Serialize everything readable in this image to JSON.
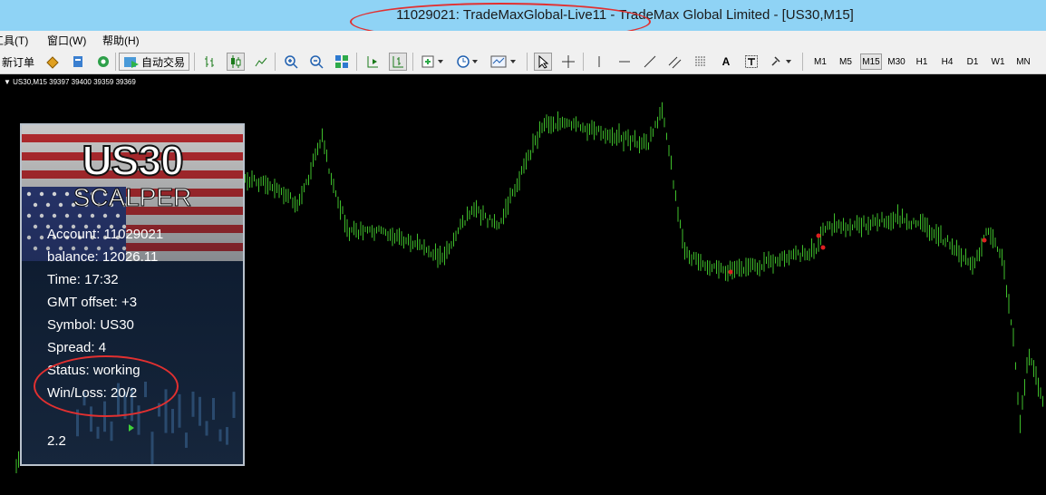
{
  "window": {
    "title": "11029021: TradeMaxGlobal-Live11 - TradeMax Global Limited - [US30,M15]"
  },
  "menu": {
    "items": [
      "工具(T)",
      "窗口(W)",
      "帮助(H)"
    ]
  },
  "toolbar": {
    "new_order_label": "新订单",
    "auto_trading_label": "自动交易",
    "text_tool_label": "A",
    "timeframes": [
      "M1",
      "M5",
      "M15",
      "M30",
      "H1",
      "H4",
      "D1",
      "W1",
      "MN"
    ],
    "active_timeframe": "M15"
  },
  "chart": {
    "header": "US30,M15  39397 39400 39359 39369",
    "bar_color": "#3fbf2b",
    "marker_color": "#e02020"
  },
  "panel": {
    "logo_title": "US30",
    "logo_subtitle": "SCALPER",
    "account": "Account: 11029021",
    "balance": "balance: 12026.11",
    "time": "Time: 17:32",
    "gmt_offset": "GMT offset: +3",
    "symbol": "Symbol: US30",
    "spread": "Spread: 4",
    "status": "Status: working",
    "win_loss": "Win/Loss: 20/2",
    "value": "2.2",
    "annotation_color": "#e23030"
  }
}
